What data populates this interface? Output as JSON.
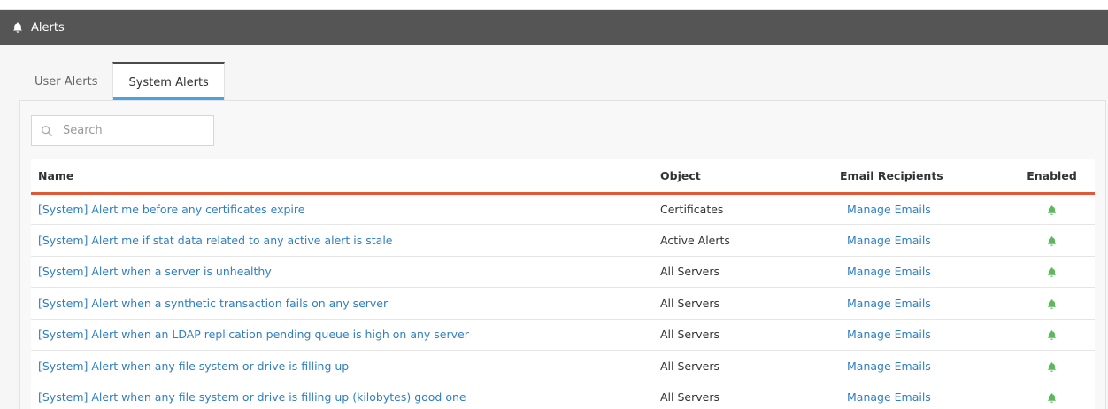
{
  "header": {
    "title": "Alerts"
  },
  "tabs": [
    {
      "label": "User Alerts",
      "active": false
    },
    {
      "label": "System Alerts",
      "active": true
    }
  ],
  "search": {
    "placeholder": "Search",
    "value": ""
  },
  "table": {
    "columns": {
      "name": "Name",
      "object": "Object",
      "email": "Email Recipients",
      "enabled": "Enabled"
    },
    "rows": [
      {
        "name": "[System] Alert me before any certificates expire",
        "object": "Certificates",
        "email": "Manage Emails",
        "enabled": true
      },
      {
        "name": "[System] Alert me if stat data related to any active alert is stale",
        "object": "Active Alerts",
        "email": "Manage Emails",
        "enabled": true
      },
      {
        "name": "[System] Alert when a server is unhealthy",
        "object": "All Servers",
        "email": "Manage Emails",
        "enabled": true
      },
      {
        "name": "[System] Alert when a synthetic transaction fails on any server",
        "object": "All Servers",
        "email": "Manage Emails",
        "enabled": true
      },
      {
        "name": "[System] Alert when an LDAP replication pending queue is high on any server",
        "object": "All Servers",
        "email": "Manage Emails",
        "enabled": true
      },
      {
        "name": "[System] Alert when any file system or drive is filling up",
        "object": "All Servers",
        "email": "Manage Emails",
        "enabled": true
      },
      {
        "name": "[System] Alert when any file system or drive is filling up (kilobytes) good one",
        "object": "All Servers",
        "email": "Manage Emails",
        "enabled": true
      }
    ]
  },
  "colors": {
    "header_bg": "#555555",
    "accent_tab": "#4aa3df",
    "table_rule": "#e05a38",
    "link": "#2f7fc0",
    "enabled_icon": "#5cb85c"
  },
  "icons": {
    "header": "bell-icon",
    "search": "search-icon",
    "enabled": "bell-icon"
  }
}
